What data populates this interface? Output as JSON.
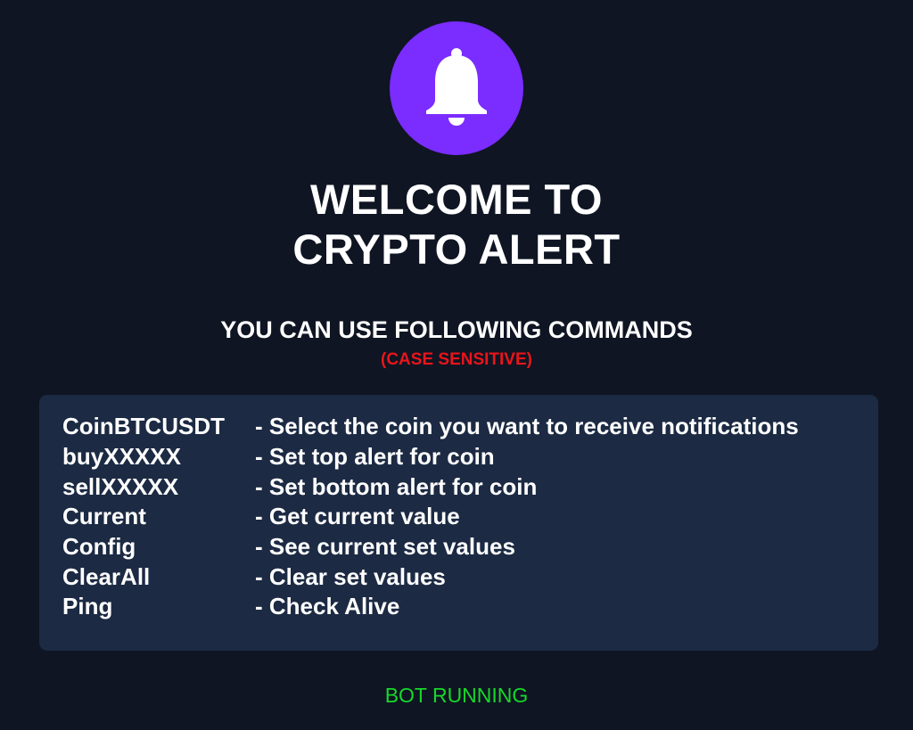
{
  "header": {
    "icon": "bell-icon",
    "badge_color": "#7b2cff",
    "title_line1": "WELCOME TO",
    "title_line2": "CRYPTO ALERT"
  },
  "instructions": {
    "heading": "YOU CAN USE FOLLOWING COMMANDS",
    "note": "(CASE SENSITIVE)",
    "note_color": "#e8151b"
  },
  "commands": [
    {
      "name": "CoinBTCUSDT",
      "desc": "- Select the coin you want to receive notifications"
    },
    {
      "name": "buyXXXXX",
      "desc": "- Set top alert for coin"
    },
    {
      "name": "sellXXXXX",
      "desc": "- Set bottom alert for coin"
    },
    {
      "name": "Current",
      "desc": "- Get current value"
    },
    {
      "name": "Config",
      "desc": "- See current set values"
    },
    {
      "name": "ClearAll",
      "desc": "- Clear set values"
    },
    {
      "name": "Ping",
      "desc": "- Check Alive"
    }
  ],
  "status": {
    "text": "BOT RUNNING",
    "color": "#17d82a"
  },
  "colors": {
    "background": "#0f1523",
    "panel": "#1c2a43"
  }
}
